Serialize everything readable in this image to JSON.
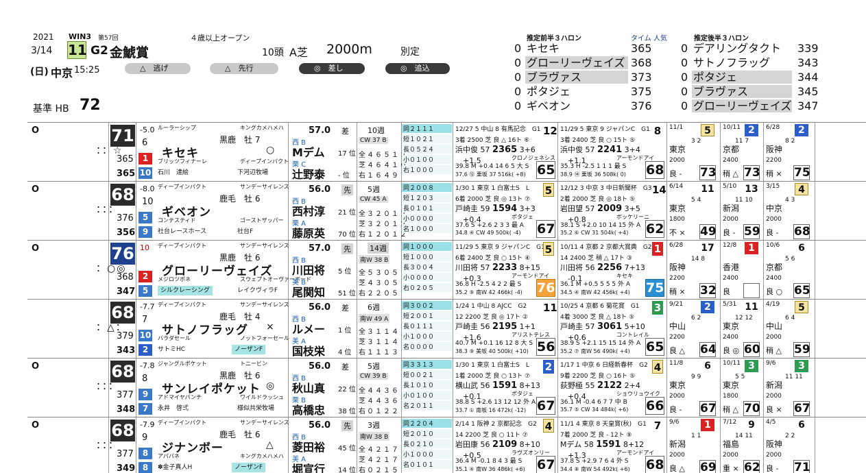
{
  "race": {
    "year": "2021",
    "date": "3/14",
    "day": "(日)",
    "venue": "中京",
    "time": "15:25",
    "win": "WIN3",
    "kai": "第57回",
    "number": "11",
    "grade": "G2",
    "name": "金鯱賞",
    "cond": "４歳以上オープン",
    "heads": "10頭",
    "track": "A芝",
    "distance": "2000m",
    "weight_rule": "別定",
    "base_label": "基準 HB",
    "base_value": "72"
  },
  "pills": [
    {
      "label": "△　逃げ"
    },
    {
      "label": "△　先行"
    },
    {
      "label": "◎　差し"
    },
    {
      "label": "◎　追込"
    }
  ],
  "pace_front": {
    "title": "推定前半３ハロン",
    "col": "タイム 人気",
    "rows": [
      {
        "z": "0",
        "name": "キセキ",
        "time": "365"
      },
      {
        "z": "0",
        "name": "グローリーヴェイズ",
        "time": "368"
      },
      {
        "z": "0",
        "name": "ブラヴァス",
        "time": "373"
      },
      {
        "z": "0",
        "name": "ポタジェ",
        "time": "375"
      },
      {
        "z": "0",
        "name": "ギベオン",
        "time": "376"
      }
    ]
  },
  "pace_back": {
    "title": "推定後半３ハロン",
    "rows": [
      {
        "z": "0",
        "name": "デアリングタクト",
        "time": "339"
      },
      {
        "z": "0",
        "name": "サトノフラッグ",
        "time": "343"
      },
      {
        "z": "0",
        "name": "ポタジェ",
        "time": "344"
      },
      {
        "z": "0",
        "name": "ブラヴァス",
        "time": "345"
      },
      {
        "z": "0",
        "name": "グローリーヴェイズ",
        "time": "347"
      }
    ]
  },
  "horses": [
    {
      "mark": "O",
      "marks": "：：☆",
      "rating": "71",
      "delta": "-5.0",
      "dnum": "6",
      "sub1": "365",
      "sub2": "365",
      "b1": "1",
      "b2": "10",
      "sire": "ルーラーシップ",
      "bsire": "キングカメハメハ",
      "coat": "黒鹿　牡 7",
      "name": "キセキ",
      "sym": "○",
      "dam": "ブリッツフィナーレ",
      "damsire": "ディープインパクト",
      "owner": "石川　達絵",
      "breeder": "下河辺牧場",
      "weight": "57.0",
      "style": "差",
      "stable": "西 B",
      "jockey": "Mデム",
      "jrank": "17 位",
      "trst": "栗 C",
      "trainer": "辻野泰",
      "trank": "- 位",
      "weeks": "10週",
      "course": "CW 37 B",
      "rec": [
        "全４６５１２",
        "芝４６４１０",
        "右１６４９"
      ],
      "grid": [
        "同２１１１",
        "短１０２１",
        "長０５２４",
        "小０１００",
        "右１０００"
      ],
      "pr": [
        {
          "l1": "12/27 5 中山 8 有馬記念　G1",
          "fin": "12",
          "fc": "n",
          "l2": "3着 2500 芝 良 △ 16ト ⑥",
          "l3": "浜中俊 57 <b>2365</b> 3+6 　+1.5",
          "l3r": "クロノジェネシス",
          "l4": "39.8 M +0.4 14 6 5 大 S",
          "l5": "37.6 ⑫ 栗坂 37 516k( +8)",
          "fig": "65",
          "fk": ""
        },
        {
          "l1": "11/29 5 東京 9 ジャパンC　G1",
          "fin": "8",
          "fc": "n",
          "l2": "3着 2400 芝 良 ○ 15ト ⑤",
          "l3": "浜中俊 57 <b>2241</b> 3+4 　+1.1",
          "l3r": "アーモンドアイ",
          "l4": "35.3 H -2.5 1 1 1 最 S",
          "l5": "38.9 ⑭ 栗坂 36 508k( 0)",
          "fig": "68",
          "fk": ""
        }
      ],
      "sb": [
        {
          "d": "11/1",
          "fin": "5",
          "fc": "y",
          "pos": "3 2",
          "pl": "東京",
          "ds": "2000",
          "gd": "良 -",
          "fig": "73"
        },
        {
          "d": "10/11",
          "fin": "2",
          "fc": "b",
          "pos": "11 7",
          "pl": "京都",
          "ds": "2400",
          "gd": "稍 △",
          "fig": "73"
        },
        {
          "d": "6/28",
          "fin": "2",
          "fc": "b",
          "pos": "8 2",
          "pl": "阪神",
          "ds": "2200",
          "gd": "稍 ×",
          "fig": "75"
        }
      ]
    },
    {
      "mark": "O",
      "marks": "：：：",
      "rating": "68",
      "delta": "-8.0",
      "dnum": "10",
      "sub1": "376",
      "sub2": "356",
      "b1": "5",
      "b2": "9",
      "sire": "ディープインパクト",
      "bsire": "サンデーサイレンス",
      "coat": "鹿毛　牡 6",
      "name": "ギベオン",
      "sym": "",
      "dam": "コンテスティド",
      "damsire": "ゴーストザッパー",
      "owner": "社台レースホース",
      "breeder": "社台F",
      "weight": "56.0",
      "style": "先",
      "stable": "西 B",
      "jockey": "西村淳",
      "jrank": "21 位",
      "trst": "栗 A",
      "trainer": "藤原英",
      "trank": "70 位",
      "weeks": "5週",
      "course": "CW 45 A",
      "rec": [
        "全３２０１２",
        "芝３２０１２",
        "右１２０１２"
      ],
      "grid": [
        "同２００８",
        "短１２０３",
        "長０１０１",
        "小００００",
        "名１０００"
      ],
      "pr": [
        {
          "l1": "1/30 1 東京 1 白富士S　L",
          "fin": "5",
          "fc": "y",
          "l2": "6着 2000 芝 良 ◎ 13ト ⑦",
          "l3": "戸崎圭 59 <b>1594</b> 3+3 　+0.4",
          "l3r": "ポタジェ",
          "l4": "37.6 S +2.6 2 3 3 最 A",
          "l5": "34.8 ④ CW 49 500k( -4)",
          "fig": "67",
          "fk": ""
        },
        {
          "l1": "12/12 3 中京 3 中日新聞杯　G3",
          "fin": "14",
          "fc": "n",
          "l2": "2着 2000 芝 良 ◎ 18ト ⑤",
          "l3": "岩田望 57 <b>2009</b> 3+5 　+0.8",
          "l3r": "ボッケリーニ",
          "l4": "38.1 S +2.0 10 14 15 外 A",
          "l5": "35.2 ⑥ CW 31 504k( +4)",
          "fig": "62",
          "fk": ""
        }
      ],
      "sb": [
        {
          "d": "6/14",
          "fin": "11",
          "fc": "n",
          "pos": "5 4",
          "pl": "東京",
          "ds": "1800",
          "gd": "不 ×",
          "fig": "49"
        },
        {
          "d": "5/10",
          "fin": "13",
          "fc": "n",
          "pos": "11 10",
          "pl": "新潟",
          "ds": "2000",
          "gd": "良 -",
          "fig": "59"
        },
        {
          "d": "3/15",
          "fin": "4",
          "fc": "y",
          "pos": "4 3",
          "pl": "中京",
          "ds": "2000",
          "gd": "良 -",
          "fig": "68"
        }
      ]
    },
    {
      "mark": "O",
      "marks": "：○◎",
      "rating": "76",
      "delta": "10",
      "dnum": "",
      "sub1": "368",
      "sub2": "347",
      "b1": "2",
      "b2": "5",
      "sire": "ディープインパクト",
      "bsire": "サンデーサイレンス",
      "coat": "黒鹿　牡 6",
      "name": "グローリーヴェイズ",
      "sym": "",
      "dam": "メジロツボネ",
      "damsire": "スウェプトオーヴァーボード",
      "owner": "シルクレーシング",
      "breeder": "レイクヴィラF",
      "weight": "57.0",
      "style": "先",
      "stable": "西 B",
      "jockey": "川田将",
      "jrank": "5 位",
      "trst": "美 B",
      "trainer": "尾関知",
      "trank": "51 位",
      "weeks": "14週",
      "course": "南W 38 B",
      "rec": [
        "全５３０５",
        "芝４３０５",
        "右２２０５"
      ],
      "grid": [
        "同１０００",
        "短１０００",
        "長３００４",
        "小００００",
        "右０２０５"
      ],
      "pr": [
        {
          "l1": "11/29 5 東京 9 ジャパンC　G1",
          "fin": "5",
          "fc": "y",
          "l2": "6着 2400 芝 良 ○ 15ト ④",
          "l3": "川田将 57 <b>2233</b> 8+15 　+0.3",
          "l3r": "アーモンドアイ",
          "l4": "36.8 H -2.5 4 2 2 最 S",
          "l5": "35.2 ⑨ 南W 42 466k( -4)",
          "fig": "76",
          "fk": "o"
        },
        {
          "l1": "10/11 4 京都 2 京都大賞典　G2",
          "fin": "1",
          "fc": "r",
          "l2": "14 2400 芝 稍 △ 17ト ③",
          "l3": "川田将 56 <b>2256</b> 7+13 　-0.1",
          "l3r": "キセキ",
          "l4": "36.1 M +0.5 5 5 5 外 A",
          "l5": "34.5 ④ 南W 42 456k( +4)",
          "fig": "75",
          "fk": "b"
        }
      ],
      "sb": [
        {
          "d": "6/28",
          "fin": "17",
          "fc": "n",
          "pos": "14 8",
          "pl": "阪神",
          "ds": "2200",
          "gd": "稍 ×",
          "fig": "32"
        },
        {
          "d": "12/8",
          "fin": "1",
          "fc": "r",
          "pos": "",
          "pl": "香港",
          "ds": "2400",
          "gd": "良",
          "fig": ""
        },
        {
          "d": "10/6",
          "fin": "6",
          "fc": "n",
          "pos": "5 6",
          "pl": "京都",
          "ds": "2400",
          "gd": "良 ○",
          "fig": "65"
        }
      ]
    },
    {
      "mark": "",
      "marks": "：△：",
      "rating": "68",
      "delta": "-7.7",
      "dnum": "7",
      "sub1": "379",
      "sub2": "343",
      "b1": "10",
      "b2": "2",
      "sire": "ディープインパクト",
      "bsire": "サンデーサイレンス",
      "coat": "鹿毛　牡 4",
      "name": "サトノフラッグ",
      "sym": "×",
      "dam": "バラダセール",
      "damsire": "ノットフォーセール",
      "owner": "サトミHC",
      "breeder": "ノーザンF",
      "weight": "56.0",
      "style": "差",
      "stable": "西 B",
      "jockey": "ルメー",
      "jrank": "1 位",
      "trst": "美 A",
      "trainer": "国枝栄",
      "trank": "4 位",
      "weeks": "6週",
      "course": "南W 49 A",
      "rec": [
        "全３１１４",
        "芝３１１４",
        "右１１１３"
      ],
      "grid": [
        "同３００２",
        "短２００１",
        "長０１１１",
        "小１０００",
        "名００００"
      ],
      "pr": [
        {
          "l1": "1/24 1 中山 8 AJCC　G2",
          "fin": "11",
          "fc": "n",
          "l2": "12 2200 芝 良 ◎ 17ト ②",
          "l3": "戸崎圭 56 <b>2195</b> 1+1 　+1.6",
          "l3r": "アリストテレス",
          "l4": "40.7 M +0.1 16 12 8 大 S",
          "l5": "38.3 ⑨ 美坂 40 500k( +10)",
          "fig": "56",
          "fk": ""
        },
        {
          "l1": "10/25 4 京都 6 菊花賞　G1",
          "fin": "3",
          "fc": "g",
          "l2": "4着 3000 芝 良 △ 18ト ⑤",
          "l3": "戸崎圭 57 <b>3061</b> 5+10 　+0.6",
          "l3r": "コントレイル",
          "l4": "38.9 S +2.1 15 15 14 外 A",
          "l5": "35.2 ⑦ 南W 56 490k( +4)",
          "fig": "65",
          "fk": ""
        }
      ],
      "sb": [
        {
          "d": "9/21",
          "fin": "2",
          "fc": "b",
          "pos": "6 2",
          "pl": "中山",
          "ds": "2200",
          "gd": "良 △",
          "fig": "64"
        },
        {
          "d": "5/31",
          "fin": "11",
          "fc": "n",
          "pos": "12 12",
          "pl": "東京",
          "ds": "2400",
          "gd": "良 ◎",
          "fig": "60"
        },
        {
          "d": "4/19",
          "fin": "5",
          "fc": "y",
          "pos": "6 4",
          "pl": "中山",
          "ds": "2000",
          "gd": "稍 △",
          "fig": "59"
        }
      ]
    },
    {
      "mark": "O",
      "marks": "：：：",
      "rating": "68",
      "delta": "-7.8",
      "dnum": "8",
      "sub1": "377",
      "sub2": "348",
      "b1": "9",
      "b2": "7",
      "sire": "ジャングルポケット",
      "bsire": "トニービン",
      "coat": "黒鹿　牡 6",
      "name": "サンレイポケット",
      "sym": "◎",
      "dam": "アドマイヤパンチ",
      "damsire": "ワイルドラッシュ",
      "owner": "永井　啓弍",
      "breeder": "様似共栄牧場",
      "weight": "56.0",
      "style": "差",
      "stable": "西 B",
      "jockey": "秋山真",
      "jrank": "22 位",
      "trst": "栗 B",
      "trainer": "高橋忠",
      "trank": "38 位",
      "weeks": "5週",
      "course": "CW 39 B",
      "rec": [
        "全４４３６",
        "芝４４３６",
        "右０１２２"
      ],
      "grid": [
        "同３３１３",
        "短００２１",
        "長１０１０",
        "小０１００",
        "名２０１１"
      ],
      "pr": [
        {
          "l1": "1/30 1 東京 1 白富士S　L",
          "fin": "2",
          "fc": "b",
          "l2": "1着 2000 芝 良 ○ 13ト ⑦",
          "l3": "横山武 56 <b>1591</b> 8+13 　+0.1",
          "l3r": "ポタジェ",
          "l4": "38.8 S +2.6 13 12 12 外 A",
          "l5": "33.7 ① 南坂 16 472k( -12)",
          "fig": "67",
          "fk": ""
        },
        {
          "l1": "1/17 1 中京 6 日経新春杯　G2",
          "fin": "4",
          "fc": "y",
          "l2": "9着 2200 芝 良 ○ 16ト ⑤",
          "l3": "荻野極 55 <b>2122</b> 2+4 　+0.4",
          "l3r": "ショウリュウイク",
          "l4": "36.1 M -0.4 6 7 7 中 B",
          "l5": "35.7 ⑤ CW 34 484k( +6)",
          "fig": "66",
          "fk": ""
        }
      ],
      "sb": [
        {
          "d": "11/8",
          "fin": "6",
          "fc": "n",
          "pos": "9 9",
          "pl": "東京",
          "ds": "2000",
          "gd": "良 -",
          "fig": "67"
        },
        {
          "d": "10/11",
          "fin": "3",
          "fc": "g",
          "pos": "5 5",
          "pl": "東京",
          "ds": "1800",
          "gd": "稍 △",
          "fig": "70"
        },
        {
          "d": "9/6",
          "fin": "3",
          "fc": "g",
          "pos": "11 11",
          "pl": "新潟",
          "ds": "2000",
          "gd": "良 ×",
          "fig": "67"
        }
      ]
    },
    {
      "mark": "O",
      "marks": "：：：",
      "rating": "68",
      "delta": "-7.9",
      "dnum": "9",
      "sub1": "377",
      "sub2": "349",
      "b1": "8",
      "b2": "8",
      "sire": "ディープインパクト",
      "bsire": "サンデーサイレンス",
      "coat": "鹿毛　牡 6",
      "name": "ジナンボー",
      "sym": "△",
      "dam": "アパパネ",
      "damsire": "キングカメハメハ",
      "owner": "✽金子真人H",
      "breeder": "ノーザンF",
      "weight": "56.0",
      "style": "先",
      "stable": "西 B",
      "jockey": "菱田裕",
      "jrank": "45 位",
      "trst": "美 A",
      "trainer": "堀宣行",
      "trank": "14 位",
      "weeks": "3週",
      "course": "南W 38 B",
      "rec": [
        "全４２１７",
        "芝４２１７",
        "右０２１５"
      ],
      "grid": [
        "同２２０４",
        "短２０１０",
        "長０２１０",
        "小１０００",
        "名０１０１"
      ],
      "pr": [
        {
          "l1": "2/14 1 阪神 2 京都記念　G2",
          "fin": "4",
          "fc": "y",
          "l2": "14 2200 芝 良 ○ 11ト ⑦",
          "l3": "岩田康 56 <b>2109</b> 8+10 　+0.5",
          "l3r": "ラヴズオンリー",
          "l4": "36.4 M -0.1 8 4 3 最 S",
          "l5": "35.1 ④ 南W 36 486k( +6)",
          "fig": "67",
          "fk": ""
        },
        {
          "l1": "11/1 4 東京 8 天皇賞(秋)　G1",
          "fin": "7",
          "fc": "n",
          "l2": "7着 2000 芝 良 - 12ト ⑨",
          "l3": "Mデム 58 <b>1591</b> 8+12 　+1.3",
          "l3r": "アーモンドアイ",
          "l4": "37.8 S +2.9 7 6 4 外 S",
          "l5": "34.4 ⑧ 南W 54 492k( +6)",
          "fig": "68",
          "fk": ""
        }
      ],
      "sb": [
        {
          "d": "9/6",
          "fin": "1",
          "fc": "r",
          "pos": "1 1",
          "pl": "新潟",
          "ds": "2000",
          "gd": "良 △",
          "fig": "69"
        },
        {
          "d": "7/12",
          "fin": "9",
          "fc": "n",
          "pos": "14 11",
          "pl": "福島",
          "ds": "2000",
          "gd": "重 ×",
          "fig": "62"
        },
        {
          "d": "4/5",
          "fin": "6",
          "fc": "n",
          "pos": "2 2",
          "pl": "阪神",
          "ds": "2000",
          "gd": "良 -",
          "fig": "71"
        }
      ]
    }
  ]
}
